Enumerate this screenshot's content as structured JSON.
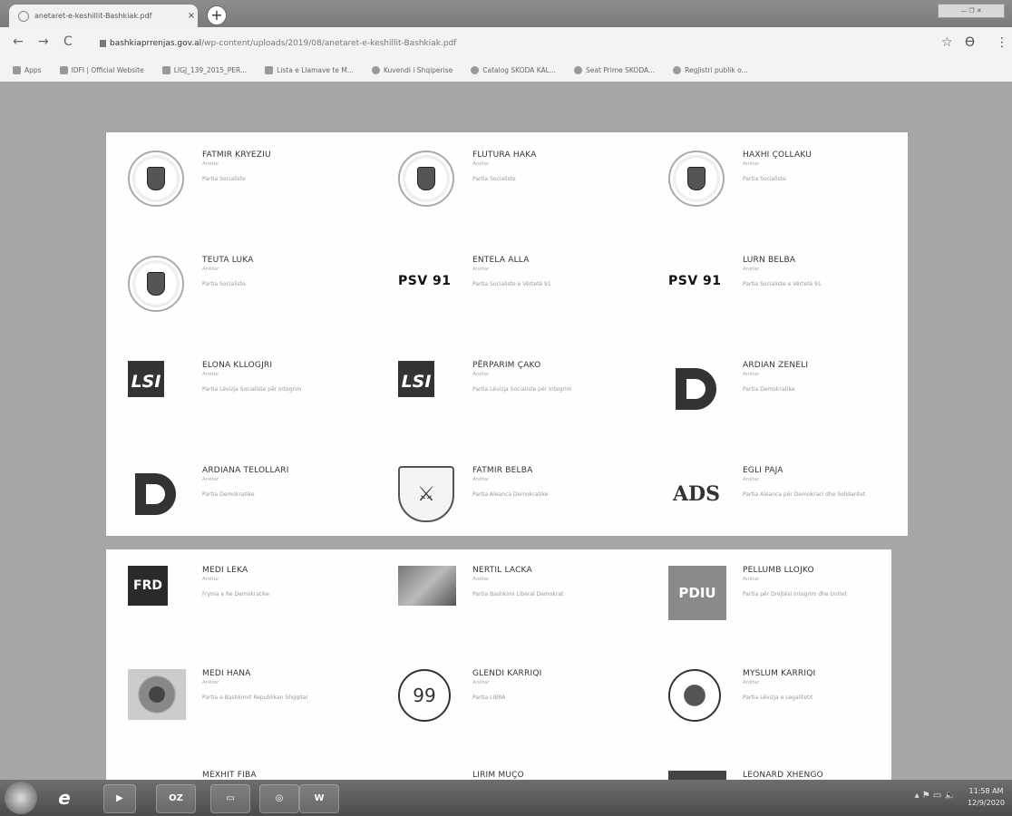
{
  "browser": {
    "tab_title": "anetaret-e-keshillit-Bashkiak.pdf",
    "tab_close": "×",
    "new_tab": "+",
    "url_host": "bashkiaprrenjas.gov.al",
    "url_path": "/wp-content/uploads/2019/08/anetaret-e-keshillit-Bashkiak.pdf",
    "back": "←",
    "forward": "→",
    "reload": "C",
    "star": "☆",
    "account": "ϴ",
    "menu": "⋮"
  },
  "bookmarks": [
    {
      "label": "Apps"
    },
    {
      "label": "IDFI | Official Website"
    },
    {
      "label": "LIGJ_139_2015_PER..."
    },
    {
      "label": "Lista e Llamave te M..."
    },
    {
      "label": "Kuvendi i Shqiperise"
    },
    {
      "label": "Catalog SKODA KAL..."
    },
    {
      "label": "Seat Prime SKODA..."
    },
    {
      "label": "Regjistri publik o..."
    }
  ],
  "members_page1": [
    {
      "name": "FATMIR KRYEZIU",
      "role": "Anëtar",
      "party": "Partia Socialiste",
      "logo": "ps-seal"
    },
    {
      "name": "FLUTURA HAKA",
      "role": "Anëtar",
      "party": "Partia Socialiste",
      "logo": "ps-seal"
    },
    {
      "name": "HAXHI ÇOLLAKU",
      "role": "Anëtar",
      "party": "Partia Socialiste",
      "logo": "ps-seal"
    },
    {
      "name": "TEUTA LUKA",
      "role": "Anëtar",
      "party": "Partia Socialiste",
      "logo": "ps-seal"
    },
    {
      "name": "ENTELA ALLA",
      "role": "Anëtar",
      "party": "Partia Socialiste e Vërtetë 91",
      "logo": "psv91",
      "logo_text": "PSV 91"
    },
    {
      "name": "LURN BELBA",
      "role": "Anëtar",
      "party": "Partia Socialiste e Vërtetë 91",
      "logo": "psv91",
      "logo_text": "PSV 91"
    },
    {
      "name": "ELONA KLLOGJRI",
      "role": "Anëtar",
      "party": "Partia Lëvizja Socialiste për Integrim",
      "logo": "lsi",
      "logo_text": "LSI"
    },
    {
      "name": "PËRPARIM ÇAKO",
      "role": "Anëtar",
      "party": "Partia Lëvizja Socialiste për Integrim",
      "logo": "lsi",
      "logo_text": "LSI"
    },
    {
      "name": "ARDIAN ZENELI",
      "role": "Anëtar",
      "party": "Partia Demokratike",
      "logo": "pd",
      "logo_text": "D"
    },
    {
      "name": "ARDIANA TELOLLARI",
      "role": "Anëtar",
      "party": "Partia Demokratike",
      "logo": "pd",
      "logo_text": "D"
    },
    {
      "name": "FATMIR BELBA",
      "role": "Anëtar",
      "party": "Partia Aleanca Demokratike",
      "logo": "shield-bird",
      "logo_text": "⚔"
    },
    {
      "name": "EGLI PAJA",
      "role": "Anëtar",
      "party": "Partia Aleanca për Demokraci dhe Solidaritet",
      "logo": "ads",
      "logo_text": "ADS"
    }
  ],
  "members_page2": [
    {
      "name": "MEDI LEKA",
      "role": "Anëtar",
      "party": "Fryma e Re Demokratike",
      "logo": "frd",
      "logo_text": "FRD"
    },
    {
      "name": "NERTIL LACKA",
      "role": "Anëtar",
      "party": "Partia Bashkimi Liberal Demokrat",
      "logo": "bird"
    },
    {
      "name": "PELLUMB LLOJKO",
      "role": "Anëtar",
      "party": "Partia për Drejtësi Integrim dhe Unitet",
      "logo": "pdiu",
      "logo_text": "PDIU"
    },
    {
      "name": "MEDI HANA",
      "role": "Anëtar",
      "party": "Partia e Bashkimit Republikan Shqiptar",
      "logo": "flower"
    },
    {
      "name": "GLENDI KARRIQI",
      "role": "Anëtar",
      "party": "Partia LIBRA",
      "logo": "ring99",
      "logo_text": "99"
    },
    {
      "name": "MYSLUM KARRIQI",
      "role": "Anëtar",
      "party": "Partia Lëvizja e Legalitetit",
      "logo": "stamp"
    },
    {
      "name": "MEXHIT FIBA",
      "role": "",
      "party": "",
      "logo": "partial"
    },
    {
      "name": "LIRIM MUÇO",
      "role": "",
      "party": "",
      "logo": "partial"
    },
    {
      "name": "LEONARD XHENGO",
      "role": "",
      "party": "",
      "logo": "partial"
    }
  ],
  "taskbar": {
    "outlook": "OZ",
    "word": "W",
    "time": "11:58 AM",
    "date": "12/9/2020"
  }
}
